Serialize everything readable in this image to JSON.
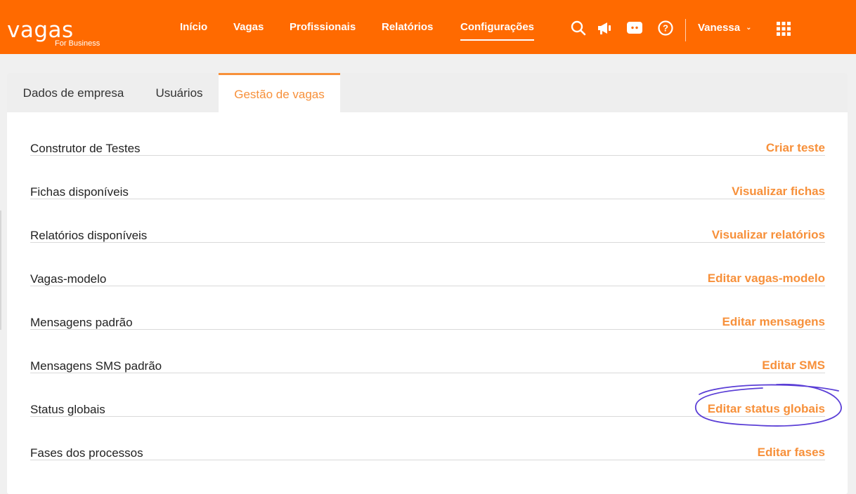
{
  "brand": {
    "name": "vagas",
    "tagline": "For Business"
  },
  "nav": {
    "items": [
      {
        "label": "Início"
      },
      {
        "label": "Vagas"
      },
      {
        "label": "Profissionais"
      },
      {
        "label": "Relatórios"
      },
      {
        "label": "Configurações",
        "active": true
      }
    ]
  },
  "header_icons": [
    "search-icon",
    "megaphone-icon",
    "chat-icon",
    "help-icon",
    "apps-grid-icon"
  ],
  "user": {
    "name": "Vanessa"
  },
  "tabs": [
    {
      "label": "Dados de empresa"
    },
    {
      "label": "Usuários"
    },
    {
      "label": "Gestão de vagas",
      "active": true
    }
  ],
  "settings_rows": [
    {
      "label": "Construtor de Testes",
      "action": "Criar teste"
    },
    {
      "label": "Fichas disponíveis",
      "action": "Visualizar fichas"
    },
    {
      "label": "Relatórios disponíveis",
      "action": "Visualizar relatórios"
    },
    {
      "label": "Vagas-modelo",
      "action": "Editar vagas-modelo"
    },
    {
      "label": "Mensagens padrão",
      "action": "Editar mensagens"
    },
    {
      "label": "Mensagens SMS padrão",
      "action": "Editar SMS"
    },
    {
      "label": "Status globais",
      "action": "Editar status globais",
      "highlighted": true
    },
    {
      "label": "Fases dos processos",
      "action": "Editar fases"
    }
  ],
  "colors": {
    "header_bg": "#ff6a00",
    "accent": "#f7903a",
    "annotation": "#5b3fd6"
  }
}
